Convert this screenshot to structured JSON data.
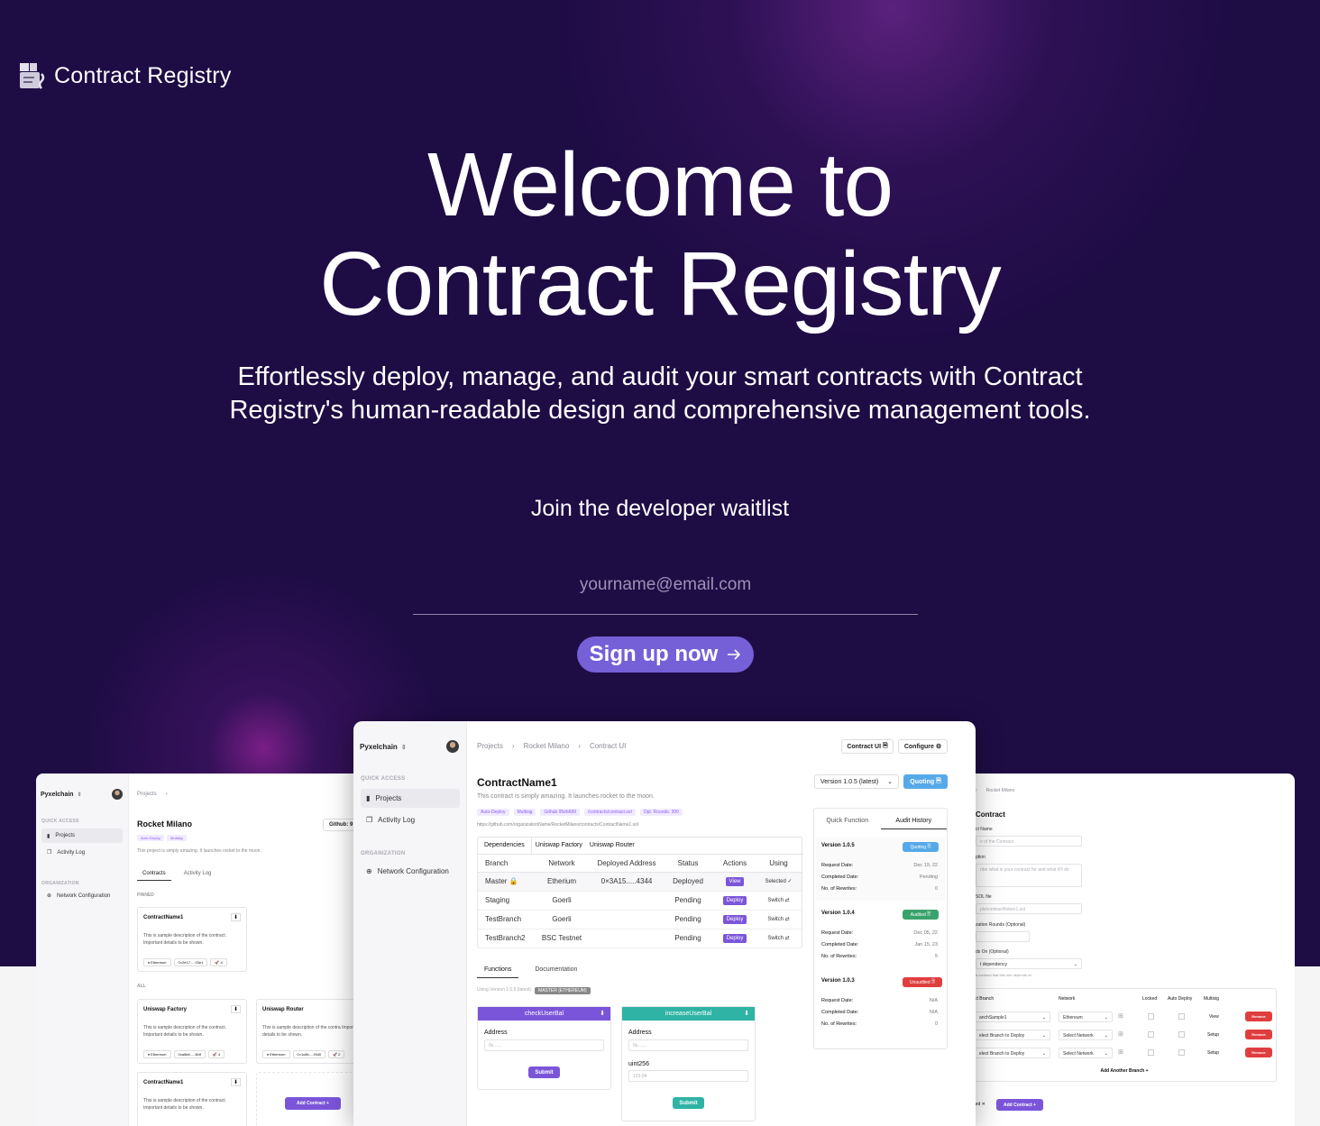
{
  "brand": {
    "name": "Contract Registry",
    "logo_icon": "registry-logo-icon"
  },
  "hero": {
    "title_line1": "Welcome to",
    "title_line2": "Contract Registry",
    "subtitle": "Effortlessly deploy, manage, and audit your smart contracts with Contract Registry's human-readable design and comprehensive management tools.",
    "waitlist_label": "Join the developer waitlist",
    "email_placeholder": "yourname@email.com",
    "signup_label": "Sign up now",
    "signup_icon": "arrow-right-icon"
  },
  "colors": {
    "background": "#1e0c45",
    "accent": "#7560d8",
    "teal": "#2fb3a5",
    "danger": "#e03e3e",
    "info": "#56a9e8"
  },
  "main_preview": {
    "org": "Pyxelchain",
    "sidebar": {
      "quick_access": "QUICK ACCESS",
      "projects": "Projects",
      "activity_log": "Activity Log",
      "organization": "ORGANIZATION",
      "network_configuration": "Network Configuration"
    },
    "breadcrumb": [
      "Projects",
      "Rocket Milano",
      "Contract UI"
    ],
    "contract_ui_button": "Contract UI",
    "configure_button": "Configure",
    "contract_name": "ContractName1",
    "contract_desc": "This contract is simply amazing. It launches rocket to the moon.",
    "tags": [
      "Auto-Deploy",
      "Multisig",
      "Github 95eb699",
      "/contracts/contract.sol",
      "Opt. Rounds: 300"
    ],
    "repo_url": "https://github.com/organizationName/RocketMilano/contracts/ContractName1.sol",
    "version_select": "Version 1.0.5 (latest)",
    "quoting_button": "Quoting",
    "dep_tabs": [
      "Dependencies",
      "Uniswap Factory",
      "Uniswap Router"
    ],
    "table_headers": [
      "Branch",
      "Network",
      "Deployed Address",
      "Status",
      "Actions",
      "Using"
    ],
    "rows": [
      {
        "branch": "Master",
        "network": "Etherium",
        "address": "0×3A15.....4344",
        "status": "Deployed",
        "action": "View",
        "using": "Selected ✓"
      },
      {
        "branch": "Staging",
        "network": "Goerli",
        "address": "",
        "status": "Pending",
        "action": "Deploy",
        "using": "Switch ⇄"
      },
      {
        "branch": "TestBranch",
        "network": "Goerli",
        "address": "",
        "status": "Pending",
        "action": "Deploy",
        "using": "Switch ⇄"
      },
      {
        "branch": "TestBranch2",
        "network": "BSC Testnet",
        "address": "",
        "status": "Pending",
        "action": "Deploy",
        "using": "Switch ⇄"
      }
    ],
    "fn_tabs": [
      "Functions",
      "Documentation"
    ],
    "using_version": "Using Version 1.0.5 (latest)",
    "master_badge": "MASTER (ETHEREUM)",
    "fn1": {
      "name": "checkUserBal",
      "address_label": "Address",
      "address_placeholder": "0x.......",
      "submit": "Submit"
    },
    "fn2": {
      "name": "increaseUserBal",
      "address_label": "Address",
      "address_placeholder": "0x.......",
      "uint_label": "uint256",
      "uint_placeholder": "123.04",
      "submit": "Submit"
    },
    "side_tabs": [
      "Quick Function",
      "Audit History"
    ],
    "versions": [
      {
        "name": "Version 1.0.5",
        "badge": "Quoting",
        "request_label": "Request Date:",
        "request": "Dec 19, 22",
        "completed_label": "Completed Date:",
        "completed": "Pending",
        "rewrites_label": "No. of Rewrites:",
        "rewrites": "0"
      },
      {
        "name": "Version 1.0.4",
        "badge": "Audited",
        "request_label": "Request Date:",
        "request": "Dec 05, 22",
        "completed_label": "Completed Date:",
        "completed": "Jan 15, 23",
        "rewrites_label": "No. of Rewrites:",
        "rewrites": "5"
      },
      {
        "name": "Version 1.0.3",
        "badge": "Unaudited",
        "request_label": "Request Date:",
        "request": "N/A",
        "completed_label": "Completed Date:",
        "completed": "N/A",
        "rewrites_label": "No. of Rewrites:",
        "rewrites": "0"
      }
    ]
  },
  "left_preview": {
    "org": "Pyxelchain",
    "sidebar": {
      "quick_access": "QUICK ACCESS",
      "projects": "Projects",
      "activity_log": "Activity Log",
      "organization": "ORGANIZATION",
      "network_configuration": "Network Configuration"
    },
    "breadcrumb": "Projects",
    "project_name": "Rocket Milano",
    "github_button": "Github: 9",
    "tags": [
      "Auto-Deploy",
      "Multisig"
    ],
    "desc": "This project is simply amazing. It launches rocket to the moon.",
    "tabs": [
      "Contracts",
      "Activity Log"
    ],
    "pinned": "PINNED",
    "all": "ALL",
    "cards": [
      {
        "title": "ContractName1",
        "desc": "This is sample description of the contract. Important details to be shown.",
        "chips": [
          "Ethereum",
          "0×2e17.....03e1",
          "4"
        ]
      },
      {
        "title": "Uniswap Factory",
        "desc": "This is sample description of the contract. Important details to be shown.",
        "chips": [
          "Ethereum",
          "0xa5b8.....3fdf",
          "4"
        ]
      },
      {
        "title": "Uniswap Router",
        "desc": "This is sample description of the contra Important details to be shown.",
        "chips": [
          "Ethereum",
          "0×1c8b.....f5d0",
          "2"
        ]
      },
      {
        "title": "ContractName1",
        "desc": "This is sample description of the contract. Important details to be shown.",
        "chips": []
      }
    ],
    "add_contract": "Add Contract"
  },
  "right_preview": {
    "breadcrumb": "Rocket Milano",
    "title": "Contract",
    "name_label": "ct Name",
    "name_placeholder": "e of the Contract",
    "desc_label": "ption",
    "desc_placeholder": "ribe what is your contract for and what it'll do",
    "sol_label": "SOL file",
    "sol_placeholder": "ple/contract/token1.sol",
    "rounds_label": "zation Rounds (Optional)",
    "depends_label": "ds On (Optional)",
    "depends_placeholder": "t dependency",
    "depends_hint": "a contract that this one depends on",
    "table_headers": [
      "ct Branch",
      "Network",
      "Locked",
      "Auto Deploy",
      "Multisig"
    ],
    "rows": [
      {
        "branch": "anchSample1",
        "network": "Ethereum",
        "action": "View",
        "remove": "Remove"
      },
      {
        "branch": "elect Branch to Deploy",
        "network": "Select Network",
        "action": "Setup",
        "remove": "Remove"
      },
      {
        "branch": "elect Branch to Deploy",
        "network": "Select Network",
        "action": "Setup",
        "remove": "Remove"
      }
    ],
    "add_branch": "Add Another Branch",
    "discard": "ard",
    "add_contract": "Add Contract"
  }
}
